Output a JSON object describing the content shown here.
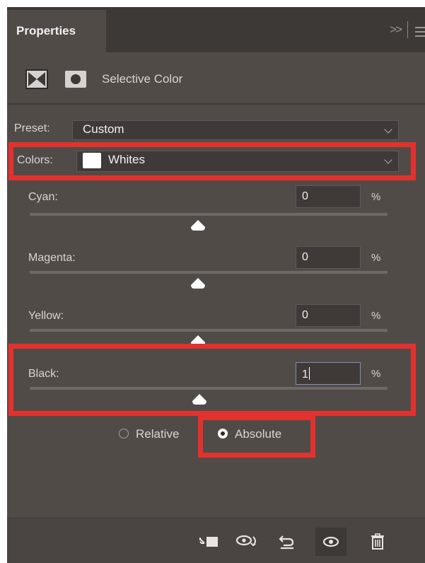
{
  "panel": {
    "tab_title": "Properties",
    "expand_icon": "double-chevron-right-icon",
    "menu_icon": "hamburger-menu-icon"
  },
  "adjustment": {
    "title": "Selective Color",
    "layer_icon": "selective-color-adjustment-icon",
    "mask_icon": "layer-mask-icon"
  },
  "preset": {
    "label": "Preset:",
    "value": "Custom"
  },
  "colors": {
    "label": "Colors:",
    "value": "Whites",
    "swatch_color": "#ffffff"
  },
  "sliders": [
    {
      "label": "Cyan:",
      "value": "0",
      "unit": "%",
      "level": 0
    },
    {
      "label": "Magenta:",
      "value": "0",
      "unit": "%",
      "level": 0
    },
    {
      "label": "Yellow:",
      "value": "0",
      "unit": "%",
      "level": 0
    },
    {
      "label": "Black:",
      "value": "1",
      "unit": "%",
      "level": 1
    }
  ],
  "method": {
    "relative_label": "Relative",
    "absolute_label": "Absolute",
    "selected": "Absolute"
  },
  "toolbar": {
    "icons": [
      "clip-to-layer-icon",
      "view-previous-state-icon",
      "reset-icon",
      "visibility-eye-icon",
      "delete-trash-icon"
    ]
  },
  "colors_theme": {
    "highlight": "#e3312e",
    "panel_bg": "#514b48",
    "header_bg": "#3d3937"
  }
}
